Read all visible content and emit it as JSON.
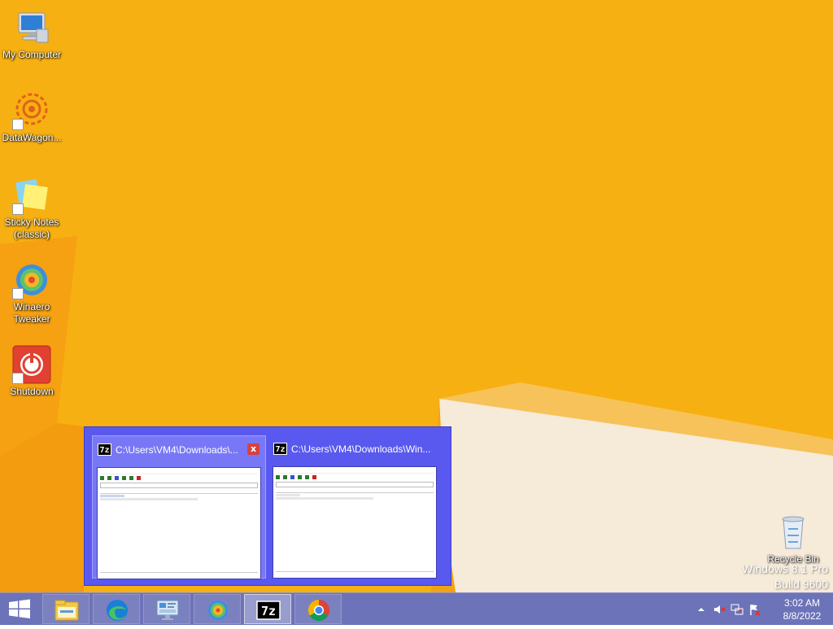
{
  "desktop": {
    "background": "#f7b011",
    "icons": [
      {
        "label": "My Computer",
        "icon": "computer-icon",
        "shortcut": false
      },
      {
        "label": "DataWagon...",
        "icon": "datawagon-icon",
        "shortcut": true
      },
      {
        "label": "Sticky Notes (classic)",
        "icon": "sticky-notes-icon",
        "shortcut": true
      },
      {
        "label": "Winaero Tweaker",
        "icon": "winaero-icon",
        "shortcut": true
      },
      {
        "label": "Shutdown",
        "icon": "power-icon",
        "shortcut": true
      }
    ],
    "recycle_bin": {
      "label": "Recycle Bin",
      "icon": "recycle-bin-icon"
    },
    "watermark": {
      "line1": "Windows 8.1 Pro",
      "line2": "Build 9600"
    }
  },
  "preview": {
    "windows": [
      {
        "title": "C:\\Users\\VM4\\Downloads\\...",
        "app_icon": "7z",
        "close": "x",
        "hovered": true
      },
      {
        "title": "C:\\Users\\VM4\\Downloads\\Win...",
        "app_icon": "7z",
        "close": "",
        "hovered": false
      }
    ]
  },
  "taskbar": {
    "color": "#6c73b8",
    "start_icon": "windows-logo-icon",
    "buttons": [
      {
        "name": "file-explorer",
        "icon": "folder-icon",
        "active": false
      },
      {
        "name": "edge",
        "icon": "edge-icon",
        "active": false
      },
      {
        "name": "control-panel",
        "icon": "control-panel-icon",
        "active": false
      },
      {
        "name": "winaero-tweaker",
        "icon": "winaero-icon",
        "active": false
      },
      {
        "name": "7zip",
        "icon": "7zip-icon",
        "label": "7z",
        "active": true
      },
      {
        "name": "chrome",
        "icon": "chrome-icon",
        "active": false
      }
    ],
    "tray": {
      "show_hidden_icon": "chevron-up-icon",
      "volume_icon": "volume-muted-icon",
      "network_icon": "network-icon",
      "action_center_icon": "action-center-flag-icon",
      "time": "3:02 AM",
      "date": "8/8/2022"
    }
  }
}
